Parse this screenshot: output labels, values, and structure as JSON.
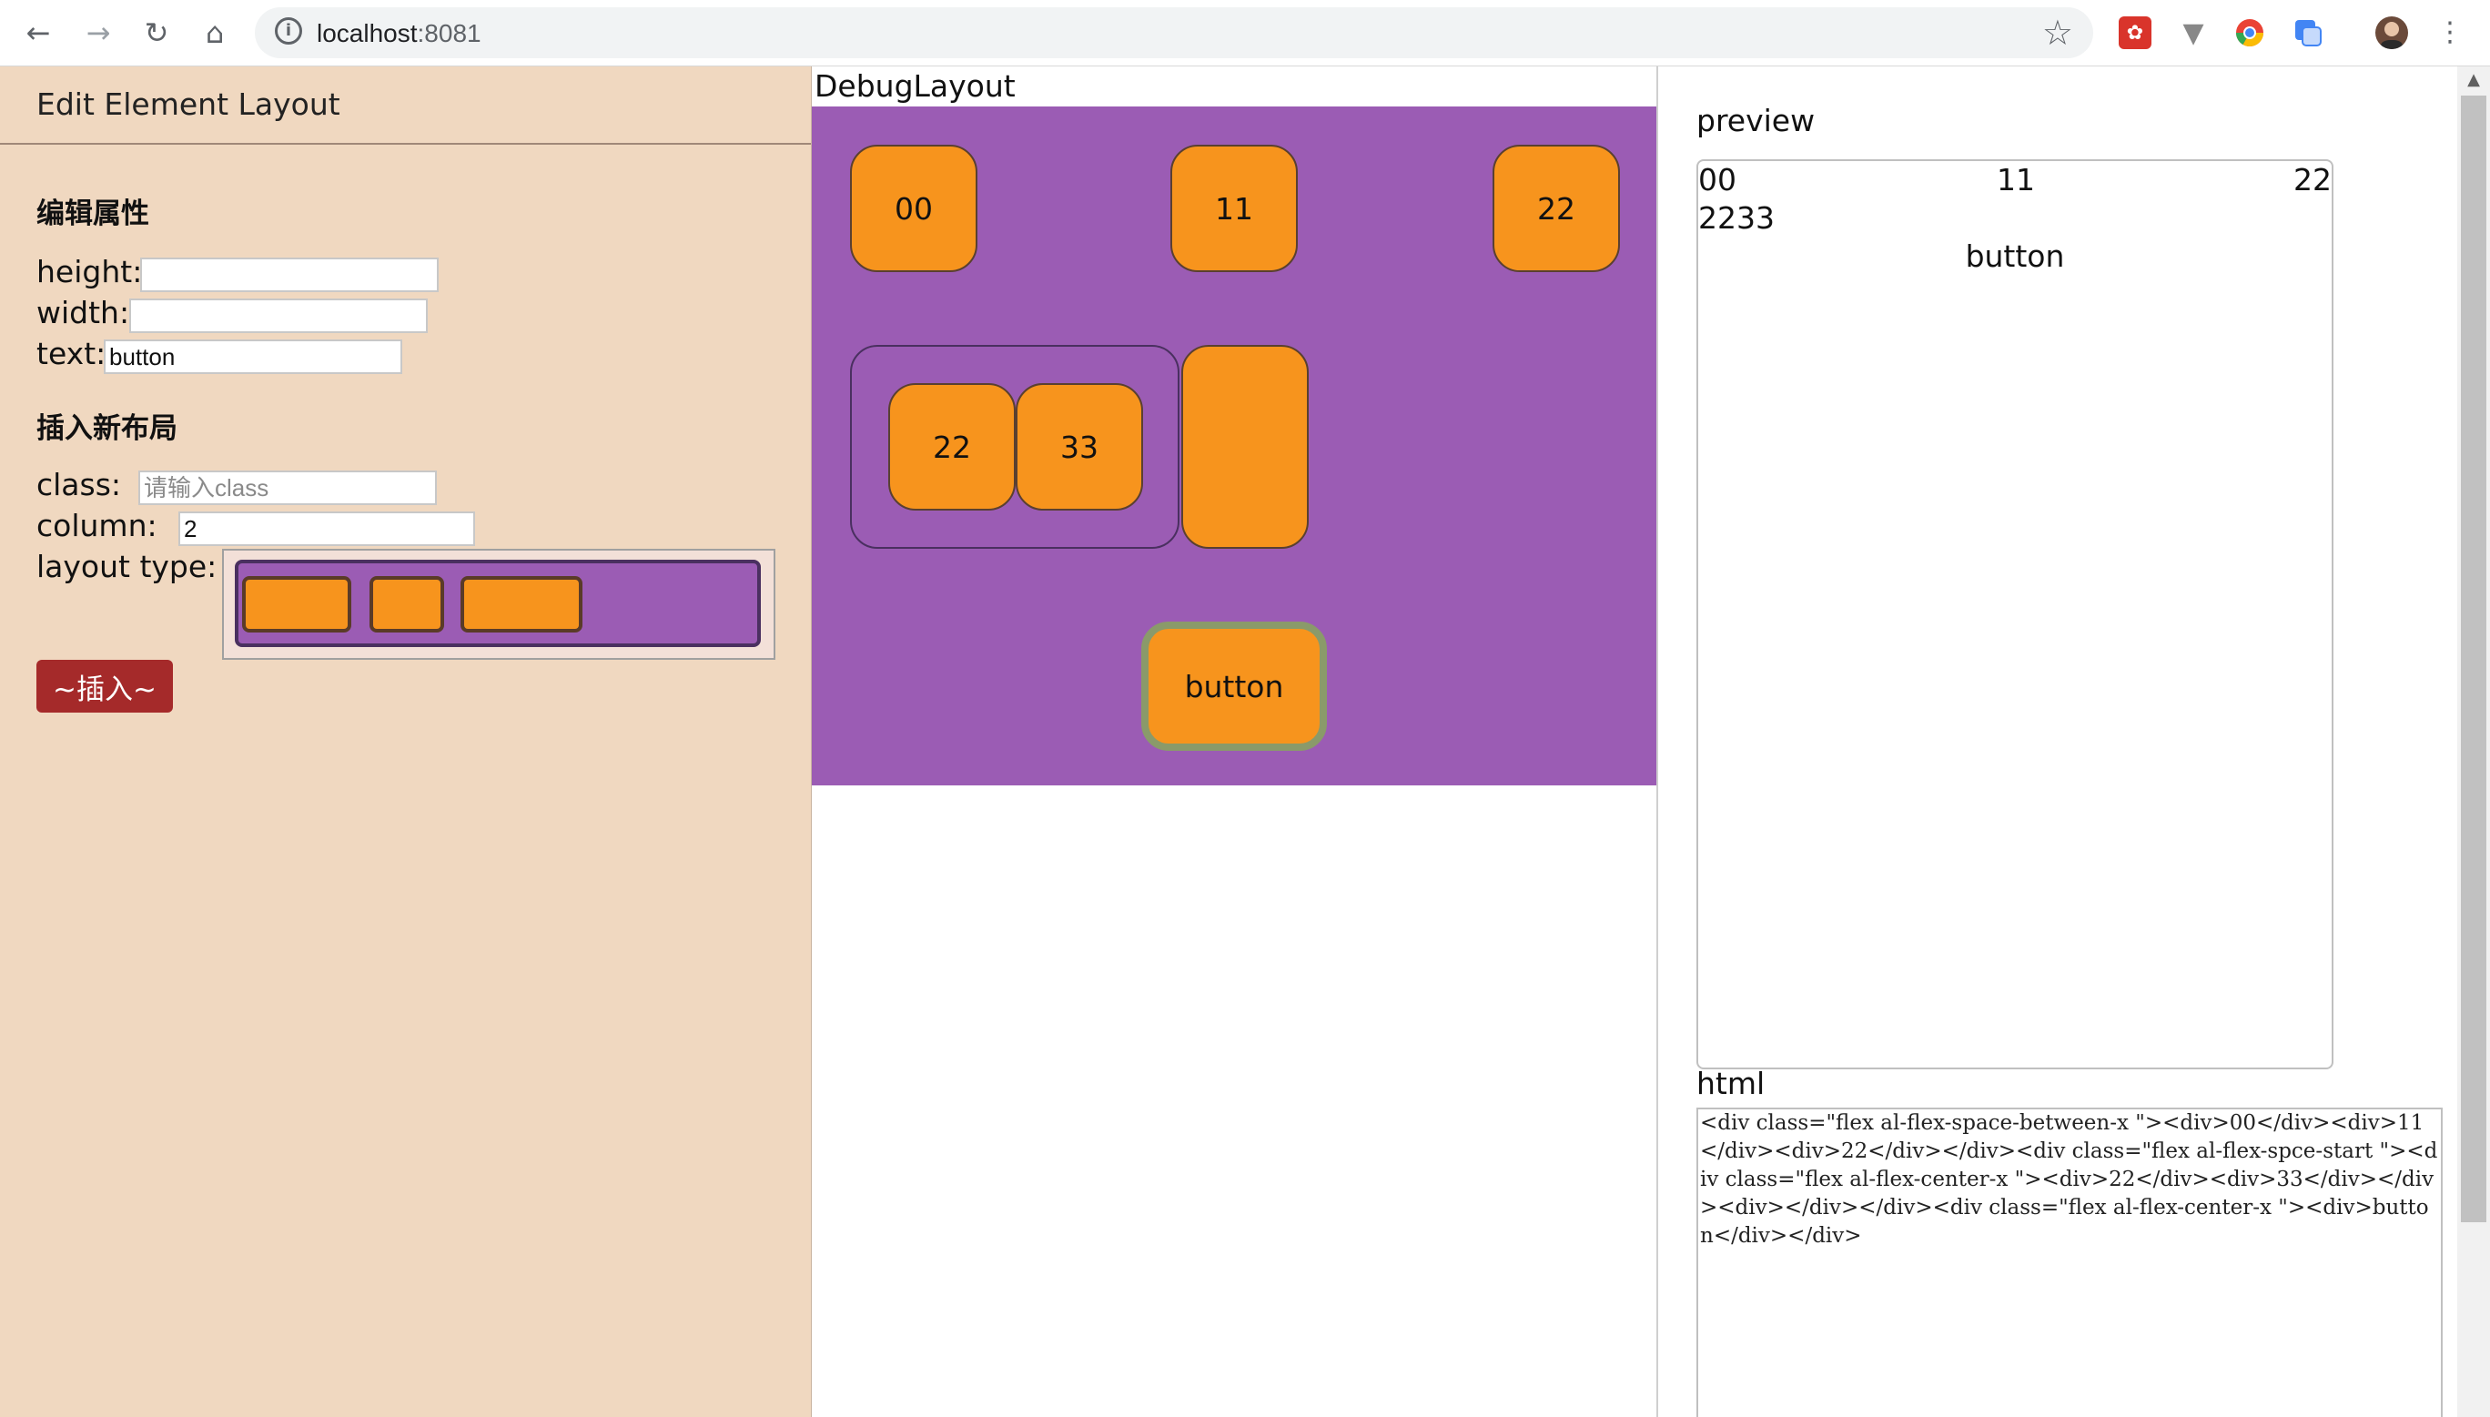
{
  "browser": {
    "url_host": "localhost",
    "url_port": ":8081"
  },
  "left_panel": {
    "header": "Edit Element Layout",
    "edit_section_title": "编辑属性",
    "height_label": "height:",
    "height_value": "",
    "width_label": "width:",
    "width_value": "",
    "text_label": "text:",
    "text_value": "button",
    "insert_section_title": "插入新布局",
    "class_label": "class:",
    "class_placeholder": "请输入class",
    "column_label": "column:",
    "column_value": "2",
    "layout_type_label": "layout type:",
    "insert_button": "~插入~"
  },
  "middle_panel": {
    "title": "DebugLayout",
    "canvas_color": "#9b5cb4",
    "tile_color": "#f7941d",
    "row1": [
      "00",
      "11",
      "22"
    ],
    "group": [
      "22",
      "33"
    ],
    "side_tile": "",
    "button_tile": "button"
  },
  "right_panel": {
    "preview_label": "preview",
    "preview": {
      "row1": [
        "00",
        "11",
        "22"
      ],
      "row2": "2233",
      "row3": "button"
    },
    "html_label": "html",
    "html_code": "<div class=\"flex al-flex-space-between-x \"><div>00</div><div>11</div><div>22</div></div><div class=\"flex al-flex-spce-start \"><div class=\"flex al-flex-center-x \"><div>22</div><div>33</div></div><div></div></div><div class=\"flex al-flex-center-x \"><div>button</div></div>"
  }
}
